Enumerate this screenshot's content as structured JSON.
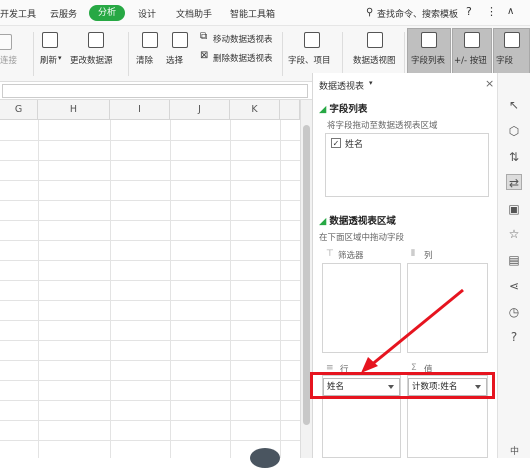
{
  "menubar": {
    "items": [
      "开发工具",
      "云服务",
      "分析",
      "设计",
      "文档助手",
      "智能工具箱"
    ],
    "active": "分析",
    "search_text": "查找命令、搜索模板",
    "help": "?",
    "more": "⋮",
    "collapse": "∧"
  },
  "ribbon": {
    "change_source_partial": "连接",
    "refresh": "刷新",
    "change_datasource": "更改数据源",
    "clear": "清除",
    "select": "选择",
    "move_pivot": "移动数据透视表",
    "delete_pivot": "删除数据透视表",
    "fields_items": "字段、项目",
    "pivot_chart": "数据透视图",
    "field_list": "字段列表",
    "plus_minus": "+/- 按钮",
    "field_headers_partial": "字段"
  },
  "grid": {
    "columns": [
      "G",
      "H",
      "I",
      "J",
      "K"
    ]
  },
  "panel": {
    "title": "数据透视表",
    "field_list_section": "字段列表",
    "field_list_hint": "将字段拖动至数据透视表区域",
    "fields": [
      {
        "name": "姓名",
        "checked": true
      }
    ],
    "areas_section": "数据透视表区域",
    "areas_hint": "在下面区域中拖动字段",
    "filter_label": "筛选器",
    "columns_label": "列",
    "rows_label": "行",
    "values_label": "值",
    "rows_value": "姓名",
    "values_value": "计数项:姓名"
  },
  "colors": {
    "accent": "#27a844",
    "highlight": "#e6141f"
  }
}
